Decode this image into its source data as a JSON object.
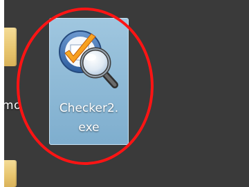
{
  "desktop": {
    "neighbour_label": "emo",
    "selected_icon": {
      "label_line1": "Checker2.",
      "label_line2": "exe",
      "glyph": "magnifier-checkmark-icon",
      "selected": true
    },
    "annotation": {
      "shape": "ellipse",
      "color": "#ff1414"
    }
  }
}
